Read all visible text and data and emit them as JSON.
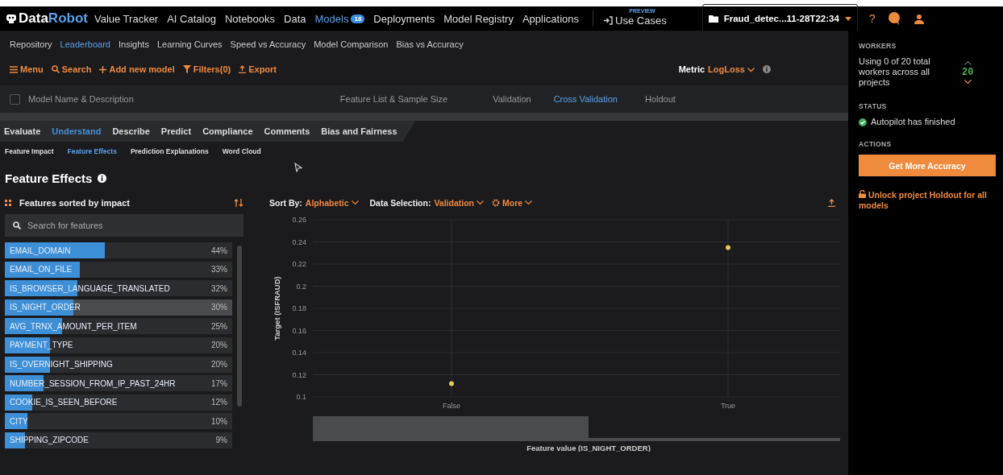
{
  "nav": {
    "brand": [
      "Data",
      "Robot"
    ],
    "items": [
      {
        "label": "Value Tracker",
        "selected": false
      },
      {
        "label": "AI Catalog",
        "selected": false
      },
      {
        "label": "Notebooks",
        "selected": false
      },
      {
        "label": "Data",
        "selected": false
      },
      {
        "label": "Models",
        "selected": true,
        "badge": "18"
      },
      {
        "label": "Deployments",
        "selected": false
      },
      {
        "label": "Model Registry",
        "selected": false
      },
      {
        "label": "Applications",
        "selected": false
      }
    ],
    "use_cases": {
      "label": "Use Cases",
      "tag": "PREVIEW"
    },
    "project": "Fraud_detec...11-28T22:34",
    "help": "?"
  },
  "project_tabs": [
    {
      "label": "Repository",
      "selected": false
    },
    {
      "label": "Leaderboard",
      "selected": true
    },
    {
      "label": "Insights",
      "selected": false
    },
    {
      "label": "Learning Curves",
      "selected": false
    },
    {
      "label": "Speed vs Accuracy",
      "selected": false
    },
    {
      "label": "Model Comparison",
      "selected": false
    },
    {
      "label": "Bias vs Accuracy",
      "selected": false
    }
  ],
  "toolbar": [
    {
      "kind": "menu",
      "label": "Menu"
    },
    {
      "kind": "search",
      "label": "Search"
    },
    {
      "kind": "add",
      "label": "Add new model"
    },
    {
      "kind": "filter",
      "label": "Filters(0)"
    },
    {
      "kind": "export",
      "label": "Export"
    }
  ],
  "metric": {
    "label": "Metric",
    "value": "LogLoss"
  },
  "select_all": {
    "checked": false
  },
  "columns": [
    {
      "label": "Model Name & Description",
      "selected": false
    },
    {
      "label": "Feature List & Sample Size",
      "selected": false
    },
    {
      "label": "Validation",
      "selected": false
    },
    {
      "label": "Cross Validation",
      "selected": true
    },
    {
      "label": "Holdout",
      "selected": false
    }
  ],
  "model_tabs": [
    {
      "label": "Evaluate",
      "selected": false
    },
    {
      "label": "Understand",
      "selected": true
    },
    {
      "label": "Describe",
      "selected": false
    },
    {
      "label": "Predict",
      "selected": false
    },
    {
      "label": "Compliance",
      "selected": false
    },
    {
      "label": "Comments",
      "selected": false
    },
    {
      "label": "Bias and Fairness",
      "selected": false
    }
  ],
  "insight_tabs": [
    {
      "label": "Feature Impact",
      "selected": false
    },
    {
      "label": "Feature Effects",
      "selected": true
    },
    {
      "label": "Prediction Explanations",
      "selected": false
    },
    {
      "label": "Word Cloud",
      "selected": false
    }
  ],
  "title": "Feature Effects",
  "features_panel": {
    "heading": "Features sorted by impact",
    "search": {
      "placeholder": "Search for features"
    },
    "features": [
      {
        "name": "EMAIL_DOMAIN",
        "percent": "44%",
        "level": 0.44,
        "selected": false
      },
      {
        "name": "EMAIL_ON_FILE",
        "percent": "33%",
        "level": 0.33,
        "selected": false
      },
      {
        "name": "IS_BROWSER_LANGUAGE_TRANSLATED",
        "percent": "32%",
        "level": 0.32,
        "selected": false
      },
      {
        "name": "IS_NIGHT_ORDER",
        "percent": "30%",
        "level": 0.3,
        "selected": true
      },
      {
        "name": "AVG_TRNX_AMOUNT_PER_ITEM",
        "percent": "25%",
        "level": 0.25,
        "selected": false
      },
      {
        "name": "PAYMENT_TYPE",
        "percent": "20%",
        "level": 0.2,
        "selected": false
      },
      {
        "name": "IS_OVERNIGHT_SHIPPING",
        "percent": "20%",
        "level": 0.2,
        "selected": false
      },
      {
        "name": "NUMBER_SESSION_FROM_IP_PAST_24HR",
        "percent": "17%",
        "level": 0.17,
        "selected": false
      },
      {
        "name": "COOKIE_IS_SEEN_BEFORE",
        "percent": "12%",
        "level": 0.12,
        "selected": false
      },
      {
        "name": "CITY",
        "percent": "10%",
        "level": 0.1,
        "selected": false
      },
      {
        "name": "SHIPPING_ZIPCODE",
        "percent": "9%",
        "level": 0.09,
        "selected": false
      }
    ]
  },
  "chart_controls": [
    {
      "kind": "select",
      "label": "Sort By:",
      "value": "Alphabetic"
    },
    {
      "kind": "select",
      "label": "Data Selection:",
      "value": "Validation"
    },
    {
      "kind": "menu",
      "value": "More"
    }
  ],
  "chart_data": {
    "type": "scatter",
    "xlabel": "Feature value (IS_NIGHT_ORDER)",
    "ylabel": "Target (ISFRAUD)",
    "categories": [
      "False",
      "True"
    ],
    "grid": true,
    "series": [
      {
        "color": "#e8c65a",
        "values": [
          0.112,
          0.235
        ]
      }
    ],
    "ylim": [
      0.1,
      0.26
    ],
    "yticks": [
      0.1,
      0.12,
      0.14,
      0.16,
      0.18,
      0.2,
      0.22,
      0.24,
      0.26
    ]
  },
  "sidebar": {
    "workers": {
      "heading": "WORKERS",
      "text": "Using 0 of 20 total workers across all projects",
      "count": "20"
    },
    "status": {
      "heading": "STATUS",
      "text": "Autopilot has finished"
    },
    "actions": {
      "heading": "ACTIONS",
      "button": "Get More Accuracy",
      "link": "Unlock project Holdout for all models"
    }
  }
}
